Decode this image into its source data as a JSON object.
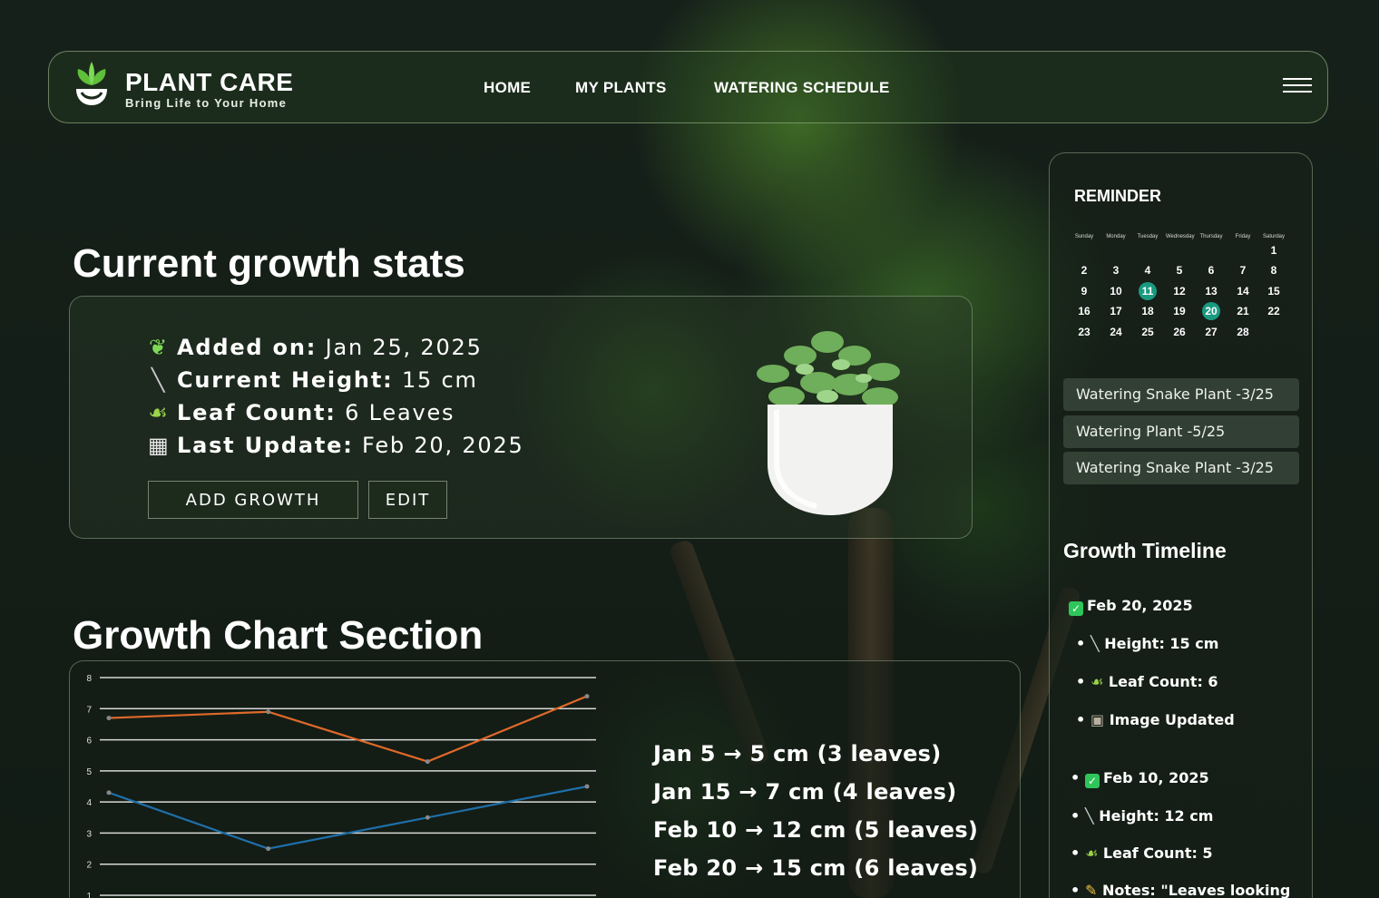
{
  "brand": {
    "title": "PLANT CARE",
    "subtitle": "Bring Life to Your Home"
  },
  "nav": {
    "items": [
      "HOME",
      "MY PLANTS",
      "WATERING SCHEDULE"
    ]
  },
  "stats": {
    "heading": "Current growth stats",
    "rows": [
      {
        "icon": "seedling-icon",
        "label": "Added on:",
        "value": "Jan 25, 2025"
      },
      {
        "icon": "ruler-icon",
        "label": "Current Height:",
        "value": "15 cm"
      },
      {
        "icon": "leaf-icon",
        "label": "Leaf Count:",
        "value": "6 Leaves"
      },
      {
        "icon": "calendar-icon",
        "label": "Last Update:",
        "value": "Feb 20, 2025"
      }
    ],
    "add_button": "ADD GROWTH",
    "edit_button": "EDIT"
  },
  "chart_section": {
    "heading": "Growth Chart Section",
    "notes": [
      "Jan 5 → 5 cm (3 leaves)",
      "Jan 15 → 7 cm (4 leaves)",
      "Feb 10 → 12 cm (5 leaves)",
      "Feb 20 → 15 cm (6 leaves)"
    ]
  },
  "chart_data": {
    "type": "line",
    "x": [
      1,
      2,
      3,
      4
    ],
    "ylim": [
      1,
      8
    ],
    "yticks": [
      "8",
      "7",
      "6",
      "5",
      "4",
      "3",
      "2",
      "1"
    ],
    "grid": true,
    "series": [
      {
        "color": "#e0692a",
        "values": [
          6.7,
          6.9,
          5.3,
          7.4
        ]
      },
      {
        "color": "#1f6fa8",
        "values": [
          4.3,
          2.5,
          3.5,
          4.5
        ]
      }
    ]
  },
  "reminder": {
    "title": "REMINDER",
    "weekdays": [
      "Sunday",
      "Monday",
      "Tuesday",
      "Wednesday",
      "Thursday",
      "Friday",
      "Saturday"
    ],
    "days": [
      "1",
      "2",
      "3",
      "4",
      "5",
      "6",
      "7",
      "8",
      "9",
      "10",
      "11",
      "12",
      "13",
      "14",
      "15",
      "16",
      "17",
      "18",
      "19",
      "20",
      "21",
      "22",
      "23",
      "24",
      "25",
      "26",
      "27",
      "28"
    ],
    "start_col": 6,
    "highlighted": [
      "11",
      "20"
    ],
    "items": [
      "Watering Snake Plant -3/25",
      "Watering Plant -5/25",
      "Watering Snake Plant -3/25"
    ]
  },
  "timeline": {
    "title": "Growth Timeline",
    "entries": [
      {
        "kind": "date",
        "icon": "check-icon",
        "text": "Feb 20, 2025"
      },
      {
        "kind": "detail",
        "icon": "ruler-icon",
        "text": "Height: 15 cm"
      },
      {
        "kind": "detail",
        "icon": "leaf-icon",
        "text": "Leaf Count: 6"
      },
      {
        "kind": "detail",
        "icon": "camera-icon",
        "text": "Image Updated"
      },
      {
        "kind": "date-bullet",
        "icon": "check-icon",
        "text": "Feb 10, 2025"
      },
      {
        "kind": "detail2",
        "icon": "ruler-icon",
        "text": "Height: 12 cm"
      },
      {
        "kind": "detail2",
        "icon": "leaf-icon",
        "text": "Leaf Count: 5"
      },
      {
        "kind": "detail2",
        "icon": "pencil-icon",
        "text": "Notes: \"Leaves looking"
      }
    ]
  }
}
